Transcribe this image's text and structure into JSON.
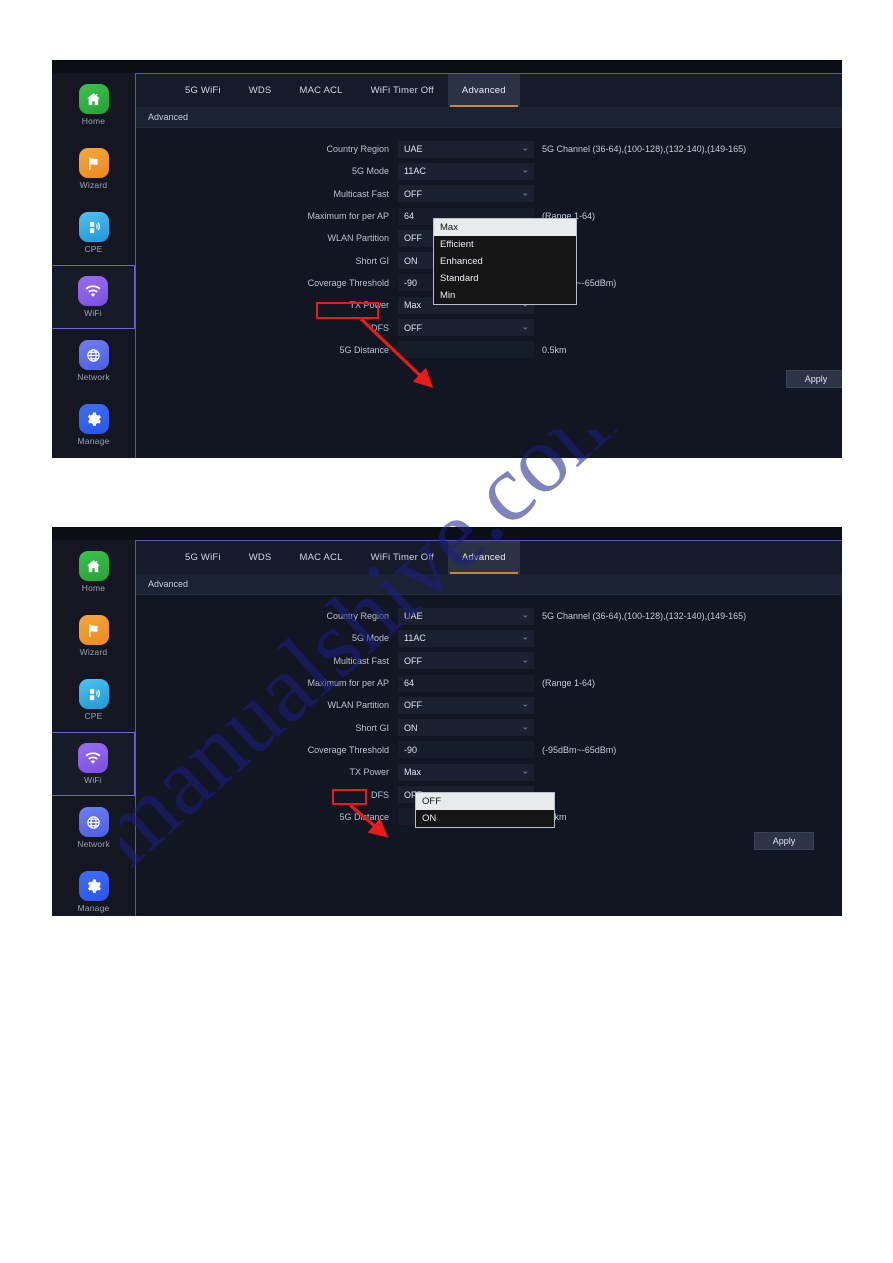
{
  "sidebar": {
    "items": [
      {
        "label": "Home",
        "icon": "home-icon",
        "active": false
      },
      {
        "label": "Wizard",
        "icon": "flag-icon",
        "active": false
      },
      {
        "label": "CPE",
        "icon": "device-icon",
        "active": false
      },
      {
        "label": "WiFi",
        "icon": "wifi-icon",
        "active": true
      },
      {
        "label": "Network",
        "icon": "globe-icon",
        "active": false
      },
      {
        "label": "Manage",
        "icon": "gear-icon",
        "active": false
      }
    ]
  },
  "tabs": [
    {
      "label": "5G WiFi",
      "active": false
    },
    {
      "label": "WDS",
      "active": false
    },
    {
      "label": "MAC ACL",
      "active": false
    },
    {
      "label": "WiFi Timer Off",
      "active": false
    },
    {
      "label": "Advanced",
      "active": true
    }
  ],
  "section_title": "Advanced",
  "form": {
    "rows": [
      {
        "label": "Country Region",
        "value": "UAE",
        "type": "select",
        "hint": "5G Channel (36-64),(100-128),(132-140),(149-165)"
      },
      {
        "label": "5G Mode",
        "value": "11AC",
        "type": "select",
        "hint": ""
      },
      {
        "label": "Multicast Fast",
        "value": "OFF",
        "type": "select",
        "hint": ""
      },
      {
        "label": "Maximum for per AP",
        "value": "64",
        "type": "input",
        "hint": "(Range 1-64)"
      },
      {
        "label": "WLAN Partition",
        "value": "OFF",
        "type": "select",
        "hint": ""
      },
      {
        "label": "Short GI",
        "value": "ON",
        "type": "select",
        "hint": ""
      },
      {
        "label": "Coverage Threshold",
        "value": "-90",
        "type": "input",
        "hint": "(-95dBm~-65dBm)"
      },
      {
        "label": "TX Power",
        "value": "Max",
        "type": "select",
        "hint": ""
      },
      {
        "label": "DFS",
        "value": "OFF",
        "type": "select",
        "hint": ""
      },
      {
        "label": "5G Distance",
        "value": "",
        "type": "text",
        "hint": "0.5km"
      }
    ]
  },
  "apply_label": "Apply",
  "panel1": {
    "highlight_label": "TX Power",
    "dropdown": {
      "name": "tx-power-dropdown",
      "options": [
        {
          "label": "Max",
          "selected": true
        },
        {
          "label": "Efficient",
          "selected": false
        },
        {
          "label": "Enhanced",
          "selected": false
        },
        {
          "label": "Standard",
          "selected": false
        },
        {
          "label": "Min",
          "selected": false
        }
      ]
    }
  },
  "panel2": {
    "highlight_label": "DFS",
    "dropdown": {
      "name": "dfs-dropdown",
      "options": [
        {
          "label": "OFF",
          "selected": true
        },
        {
          "label": "ON",
          "selected": false
        }
      ]
    }
  },
  "watermark": {
    "text": "manualshive.com"
  },
  "colors": {
    "page_bg": "#ffffff",
    "panel_bg": "#10131c",
    "content_bg": "#121623",
    "sidebar_bg": "#141722",
    "tabbar_bg": "#151b2b",
    "tab_active_bg": "#2a3244",
    "tab_underline": "#d08a2c",
    "field_bg": "#1a2030",
    "panel_border": "#5b54b8",
    "annotation_red": "#e81b1b",
    "watermark_blue": "#1b1f86",
    "apply_bg": "#2d3448"
  }
}
